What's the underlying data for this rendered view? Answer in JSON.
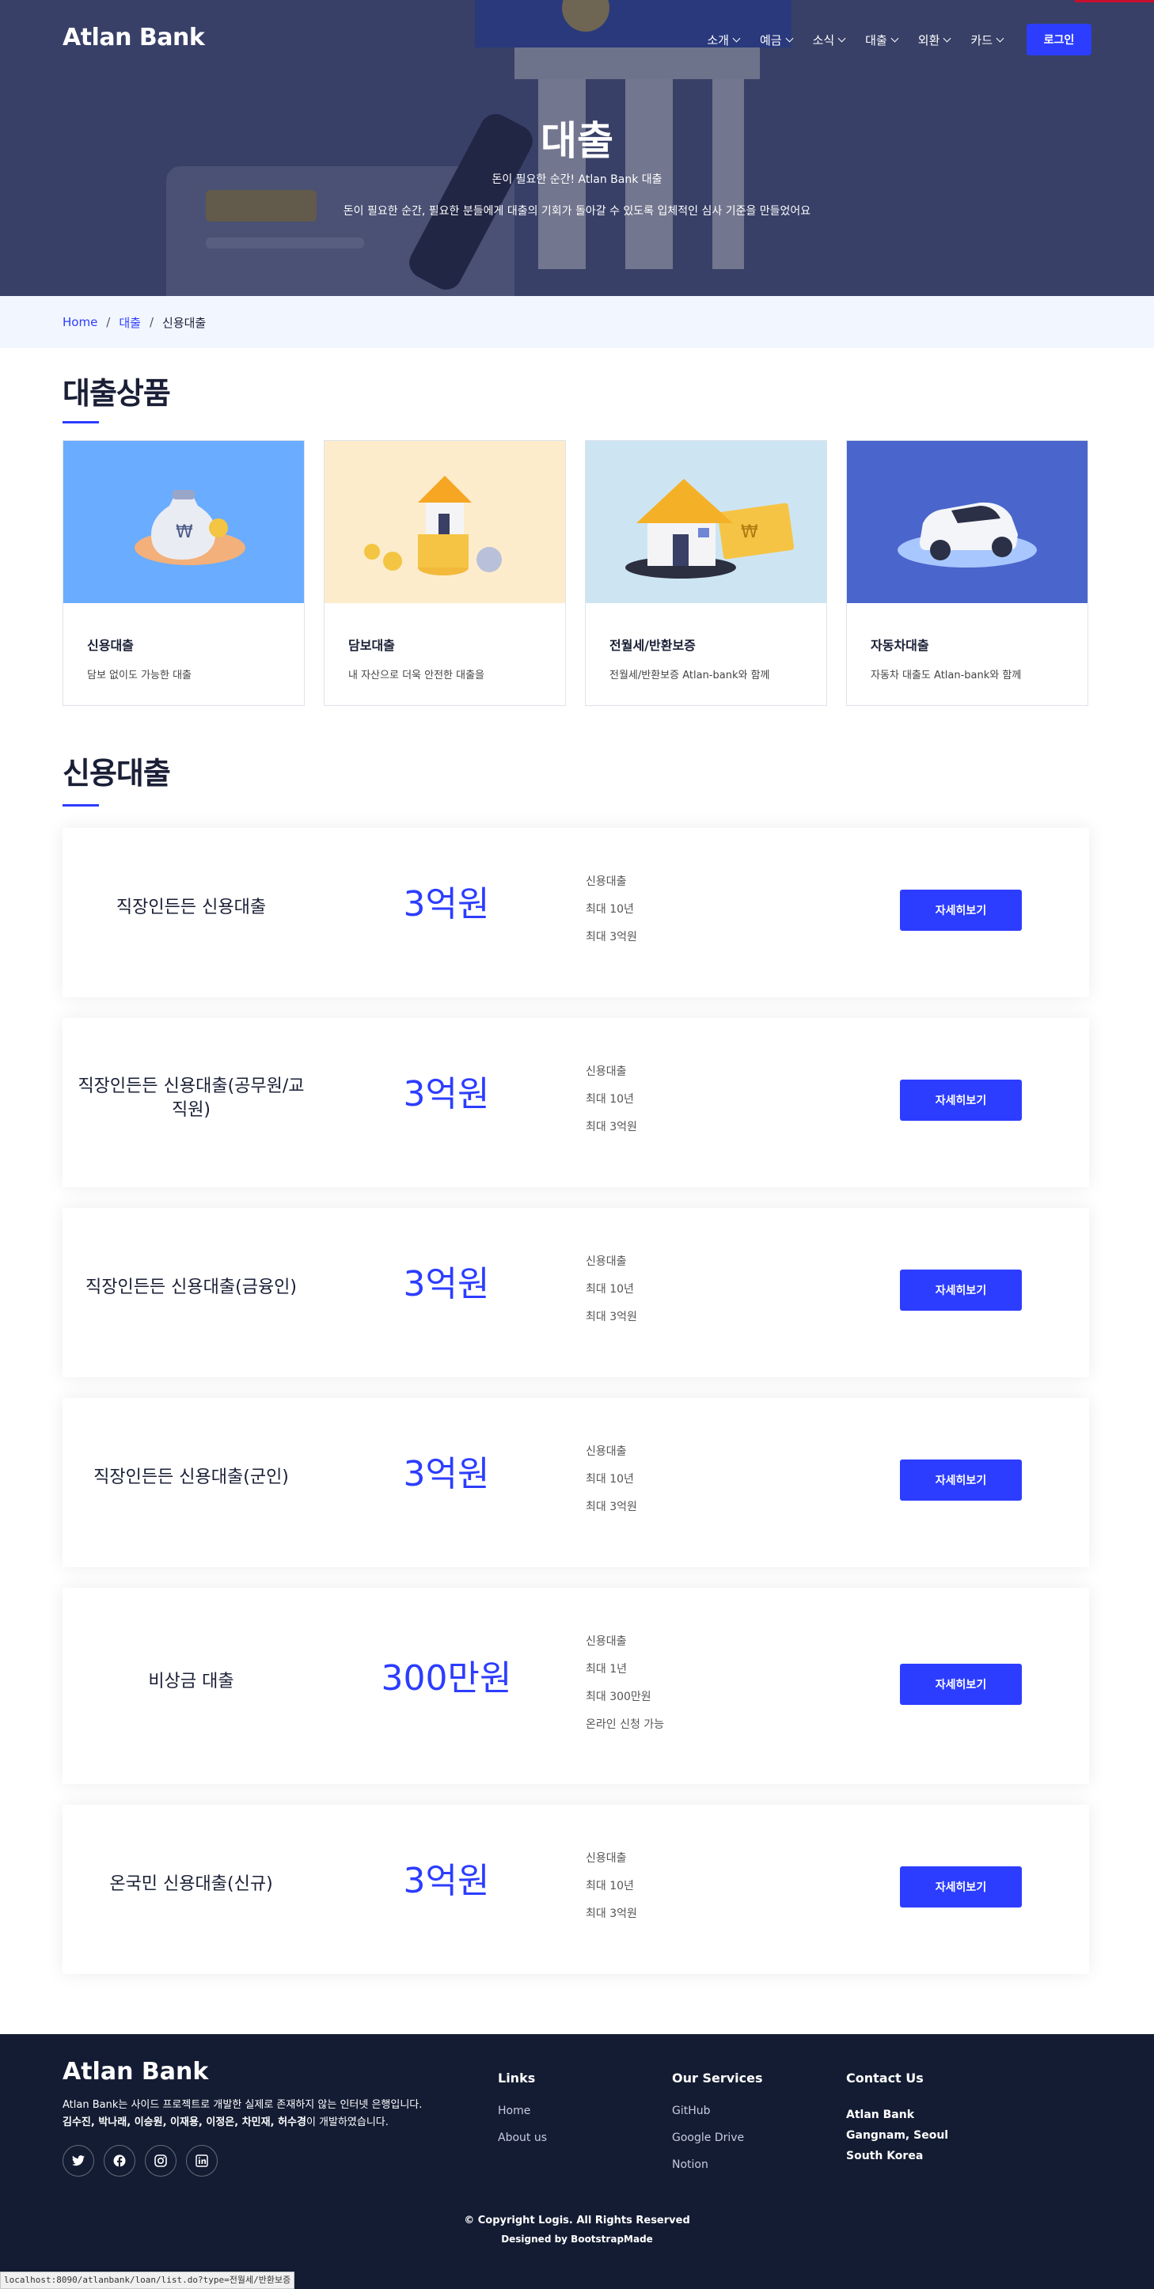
{
  "header": {
    "brand": "Atlan Bank",
    "nav": [
      {
        "label": "소개"
      },
      {
        "label": "예금"
      },
      {
        "label": "소식"
      },
      {
        "label": "대출"
      },
      {
        "label": "외환"
      },
      {
        "label": "카드"
      }
    ],
    "login_label": "로그인"
  },
  "hero": {
    "title": "대출",
    "subtitle": "돈이 필요한 순간! Atlan Bank 대출",
    "description": "돈이 필요한 순간, 필요한 분들에게 대출의 기회가 돌아갈 수 있도록 입체적인 심사 기준을 만들었어요"
  },
  "breadcrumb": {
    "home": "Home",
    "category": "대출",
    "current": "신용대출"
  },
  "products": {
    "title": "대출상품",
    "items": [
      {
        "title": "신용대출",
        "desc": "담보 없이도 가능한 대출",
        "bg": "#6aacff"
      },
      {
        "title": "담보대출",
        "desc": "내 자산으로 더욱 안전한 대출을",
        "bg": "#fdeccb"
      },
      {
        "title": "전월세/반환보증",
        "desc": "전월세/반환보증 Atlan-bank와 함께",
        "bg": "#cde5f3"
      },
      {
        "title": "자동차대출",
        "desc": "자동차 대출도 Atlan-bank와 함께",
        "bg": "#4a66cc"
      }
    ]
  },
  "credit": {
    "title": "신용대출",
    "detail_label": "자세히보기",
    "loans": [
      {
        "name": "직장인든든 신용대출",
        "amount": "3억원",
        "features": [
          "신용대출",
          "최대 10년",
          "최대 3억원"
        ]
      },
      {
        "name": "직장인든든 신용대출(공무원/교직원)",
        "amount": "3억원",
        "features": [
          "신용대출",
          "최대 10년",
          "최대 3억원"
        ]
      },
      {
        "name": "직장인든든 신용대출(금융인)",
        "amount": "3억원",
        "features": [
          "신용대출",
          "최대 10년",
          "최대 3억원"
        ]
      },
      {
        "name": "직장인든든 신용대출(군인)",
        "amount": "3억원",
        "features": [
          "신용대출",
          "최대 10년",
          "최대 3억원"
        ]
      },
      {
        "name": "비상금 대출",
        "amount": "300만원",
        "features": [
          "신용대출",
          "최대 1년",
          "최대 300만원",
          "온라인 신청 가능"
        ]
      },
      {
        "name": "온국민 신용대출(신규)",
        "amount": "3억원",
        "features": [
          "신용대출",
          "최대 10년",
          "최대 3억원"
        ]
      }
    ]
  },
  "footer": {
    "brand": "Atlan Bank",
    "description": "Atlan Bank는 사이드 프로젝트로 개발한 실제로 존재하지 않는 인터넷 은행입니다.",
    "team_names": "김수진, 박나래, 이승원, 이재용, 이정은, 차민재, 허수경",
    "team_suffix": "이 개발하였습니다.",
    "socials": [
      "twitter-icon",
      "facebook-icon",
      "instagram-icon",
      "linkedin-icon"
    ],
    "links_title": "Links",
    "links": [
      "Home",
      "About us"
    ],
    "services_title": "Our Services",
    "services": [
      "GitHub",
      "Google Drive",
      "Notion"
    ],
    "contact_title": "Contact Us",
    "contact_lines": [
      "Atlan Bank",
      "Gangnam, Seoul",
      "South Korea"
    ],
    "copyright": "© Copyright Logis. All Rights Reserved",
    "designed_by": "Designed by BootstrapMade"
  },
  "status_url": "localhost:8090/atlanbank/loan/list.do?type=전월세/반환보증"
}
